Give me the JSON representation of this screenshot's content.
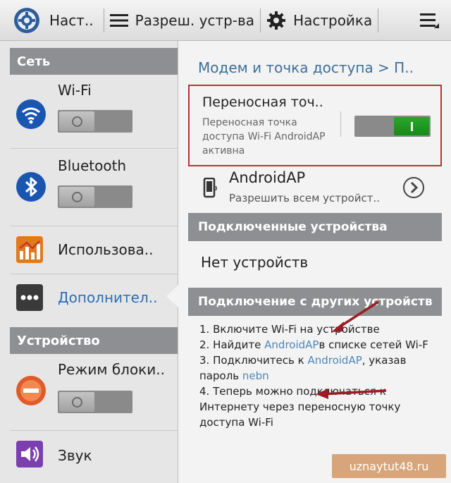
{
  "topbar": {
    "app_title": "Наст..",
    "permissions_label": "Разреш. устр-ва",
    "settings_label": "Настройка"
  },
  "sidebar": {
    "network_header": "Сеть",
    "wifi_label": "Wi-Fi",
    "bluetooth_label": "Bluetooth",
    "usage_label": "Использова..",
    "more_label": "Дополнител..",
    "device_header": "Устройство",
    "block_mode_label": "Режим блоки..",
    "sound_label": "Звук",
    "wifi_toggle_state": "off",
    "bluetooth_toggle_state": "off",
    "block_mode_toggle_state": "off"
  },
  "main": {
    "breadcrumb": "Модем и точка доступа > П..",
    "hotspot": {
      "title": "Переносная точ..",
      "subtitle": "Переносная точка доступа Wi-Fi AndroidAP активна",
      "switch_state": "on"
    },
    "ap": {
      "name": "AndroidAP",
      "subtitle": "Разрешить всем устройст.."
    },
    "connected_header": "Подключенные устройства",
    "no_devices": "Нет устройств",
    "connect_header": "Подключение с других устройств",
    "instructions": {
      "s1": "1. Включите Wi-Fi на устройстве",
      "s2a": "2. Найдите ",
      "s2_ap": "AndroidAP",
      "s2b": "в списке сетей Wi-F",
      "s3a": "3. Подключитесь к ",
      "s3_ap": "AndroidAP",
      "s3b": ", указав пароль ",
      "s3_pw": "nebn",
      "s4": "4. Теперь можно подключаться к Интернету через переносную точку доступа Wi-Fi"
    }
  },
  "watermark": "uznaytut48.ru",
  "colors": {
    "section_header": "#8d8f92",
    "active_text": "#2b6fb6",
    "switch_on": "#1f9a1f",
    "highlight_box": "#b3343a",
    "arrow": "#9b1c22"
  }
}
